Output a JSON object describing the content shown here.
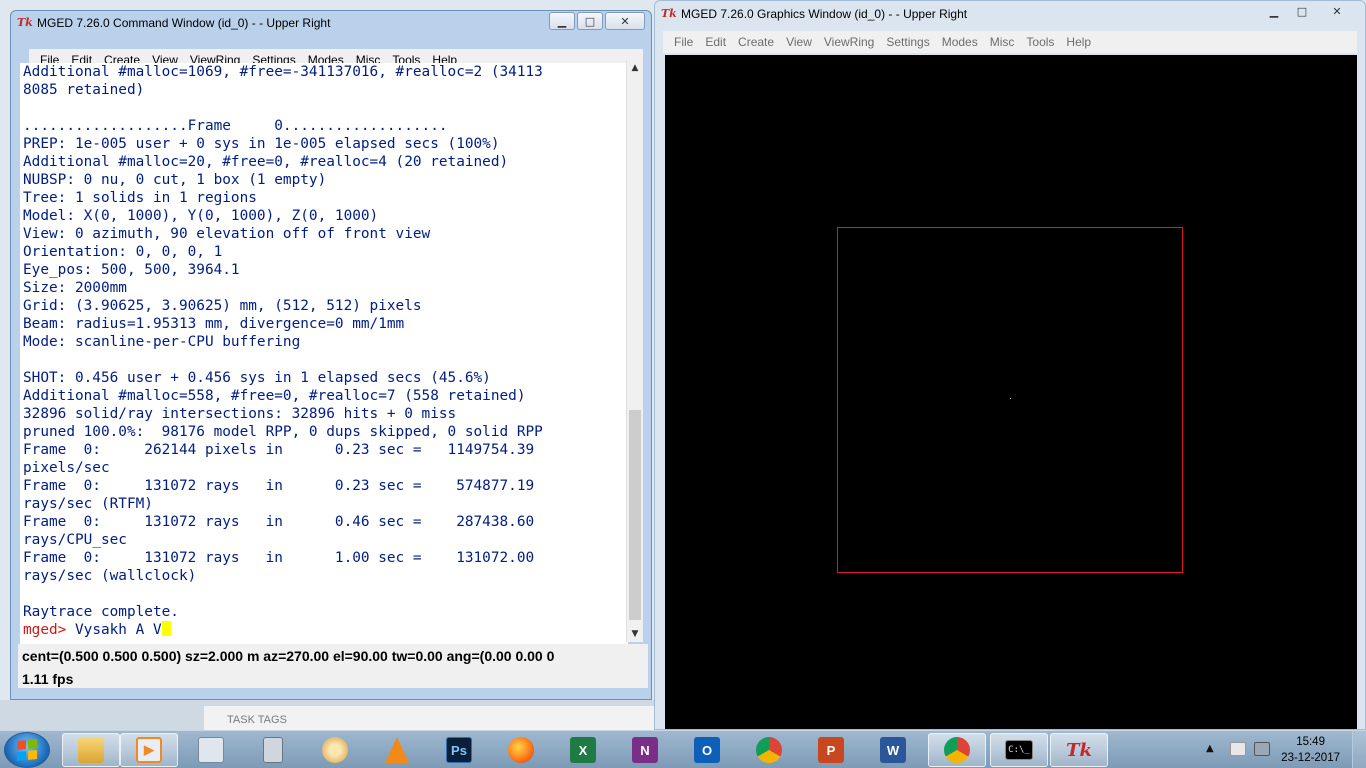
{
  "command_window": {
    "title": "MGED 7.26.0 Command Window (id_0) -  - Upper Right",
    "caption_buttons": {
      "minimize": "▁",
      "maximize": "□",
      "close": "✕"
    },
    "menu": [
      "File",
      "Edit",
      "Create",
      "View",
      "ViewRing",
      "Settings",
      "Modes",
      "Misc",
      "Tools",
      "Help"
    ],
    "console_lines": [
      "Additional #malloc=1069, #free=-341137016, #realloc=2 (34113",
      "8085 retained)",
      "",
      "...................Frame     0...................",
      "PREP: 1e-005 user + 0 sys in 1e-005 elapsed secs (100%)",
      "Additional #malloc=20, #free=0, #realloc=4 (20 retained)",
      "NUBSP: 0 nu, 0 cut, 1 box (1 empty)",
      "Tree: 1 solids in 1 regions",
      "Model: X(0, 1000), Y(0, 1000), Z(0, 1000)",
      "View: 0 azimuth, 90 elevation off of front view",
      "Orientation: 0, 0, 0, 1",
      "Eye_pos: 500, 500, 3964.1",
      "Size: 2000mm",
      "Grid: (3.90625, 3.90625) mm, (512, 512) pixels",
      "Beam: radius=1.95313 mm, divergence=0 mm/1mm",
      "Mode: scanline-per-CPU buffering",
      "",
      "SHOT: 0.456 user + 0.456 sys in 1 elapsed secs (45.6%)",
      "Additional #malloc=558, #free=0, #realloc=7 (558 retained)",
      "32896 solid/ray intersections: 32896 hits + 0 miss",
      "pruned 100.0%:  98176 model RPP, 0 dups skipped, 0 solid RPP",
      "Frame  0:     262144 pixels in      0.23 sec =   1149754.39",
      "pixels/sec",
      "Frame  0:     131072 rays   in      0.23 sec =    574877.19",
      "rays/sec (RTFM)",
      "Frame  0:     131072 rays   in      0.46 sec =    287438.60",
      "rays/CPU_sec",
      "Frame  0:     131072 rays   in      1.00 sec =    131072.00",
      "rays/sec (wallclock)",
      "",
      "Raytrace complete."
    ],
    "prompt": "mged>",
    "command_input": " Vysakh A V",
    "status_line": "cent=(0.500 0.500 0.500) sz=2.000  m  az=270.00  el=90.00  tw=0.00  ang=(0.00 0.00 0",
    "fps": "1.11 fps",
    "scroll_up": "▲",
    "scroll_down": "▼"
  },
  "graphics_window": {
    "title": "MGED 7.26.0 Graphics Window (id_0) -  - Upper Right",
    "caption_buttons": {
      "minimize": "▁",
      "maximize": "□",
      "close": "✕"
    },
    "menu": [
      "File",
      "Edit",
      "Create",
      "View",
      "ViewRing",
      "Settings",
      "Modes",
      "Misc",
      "Tools",
      "Help"
    ],
    "colors": {
      "background": "#000000",
      "wireframe": "#e01a1a"
    }
  },
  "desktop": {
    "task_tags": "TASK TAGS"
  },
  "taskbar": {
    "items": [
      {
        "name": "windows-explorer",
        "label": ""
      },
      {
        "name": "media-player",
        "label": ""
      },
      {
        "name": "on-screen-keyboard",
        "label": ""
      },
      {
        "name": "calculator",
        "label": ""
      },
      {
        "name": "paint",
        "label": ""
      },
      {
        "name": "vlc",
        "label": ""
      },
      {
        "name": "photoshop",
        "label": "Ps"
      },
      {
        "name": "firefox",
        "label": ""
      },
      {
        "name": "excel",
        "label": "X"
      },
      {
        "name": "onenote",
        "label": "N"
      },
      {
        "name": "outlook",
        "label": "O"
      },
      {
        "name": "chrome",
        "label": ""
      },
      {
        "name": "powerpoint",
        "label": "P"
      },
      {
        "name": "word",
        "label": "W"
      },
      {
        "name": "chrome-2",
        "label": ""
      },
      {
        "name": "command-prompt",
        "label": "C:\\_"
      },
      {
        "name": "mged-tk",
        "label": "Tk"
      }
    ],
    "clock": {
      "time": "15:49",
      "date": "23-12-2017"
    },
    "tray_up": "▲"
  }
}
